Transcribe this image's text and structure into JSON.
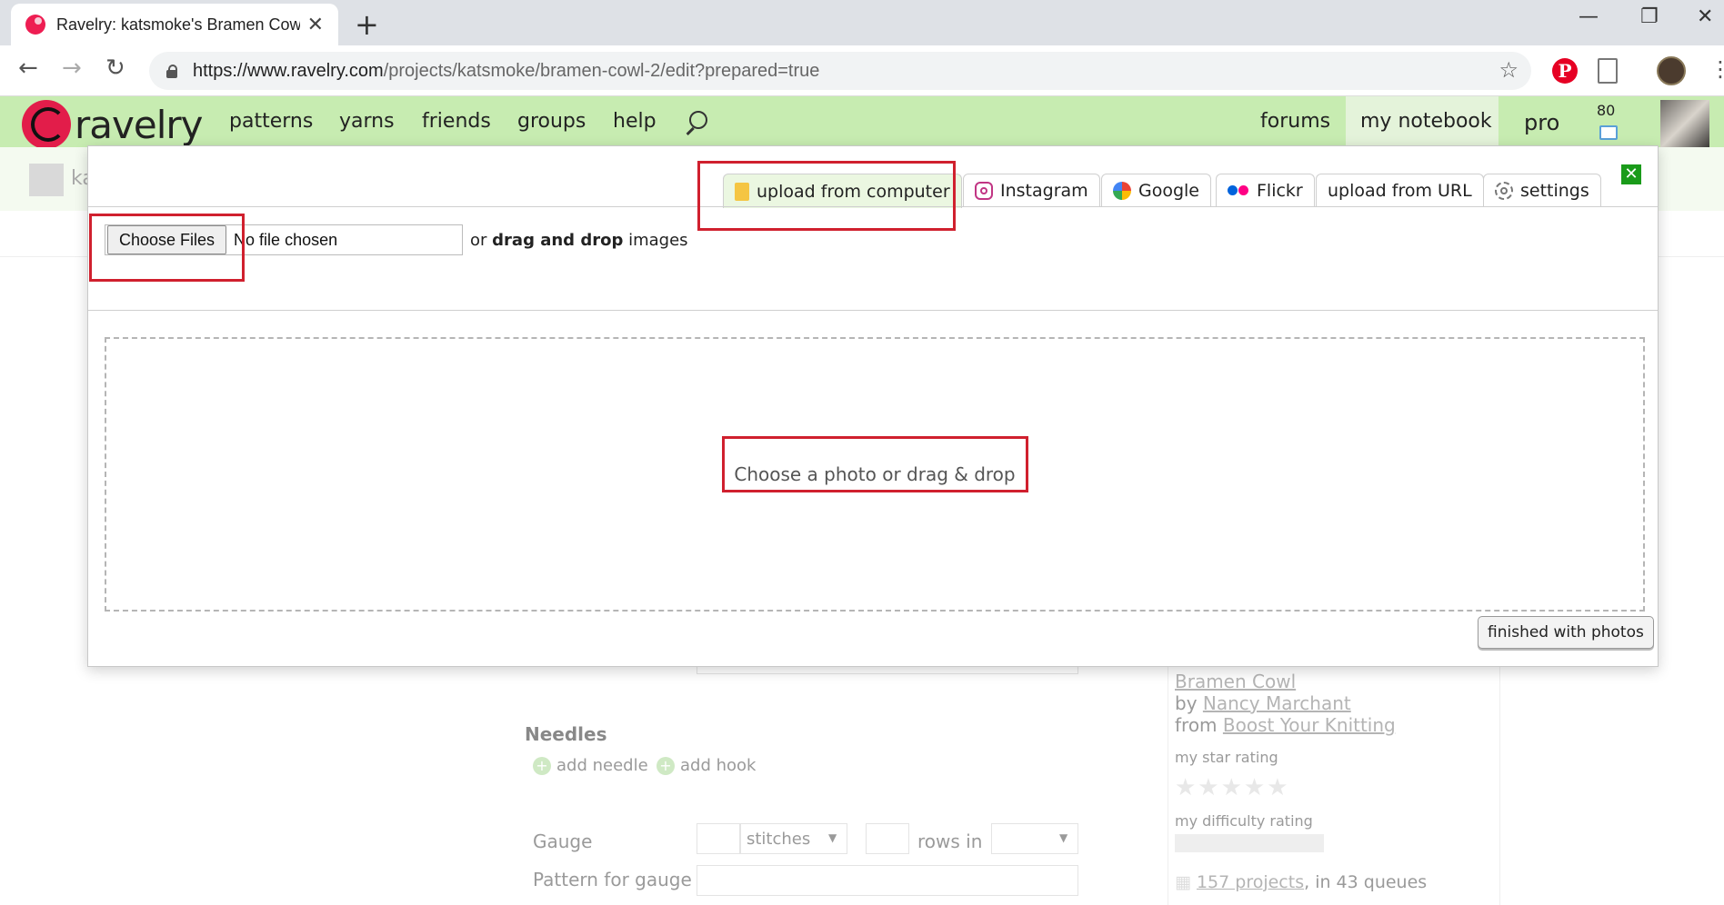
{
  "browser": {
    "tab_title": "Ravelry: katsmoke's Bramen Cowl",
    "tab_close": "✕",
    "new_tab": "+",
    "url_host": "https://www.ravelry.com",
    "url_path": "/projects/katsmoke/bramen-cowl-2/edit?prepared=true"
  },
  "ravelry_nav": {
    "logo": "ravelry",
    "items": [
      "patterns",
      "yarns",
      "friends",
      "groups",
      "help"
    ],
    "right": [
      "forums",
      "my notebook",
      "pro"
    ],
    "notification_count": "80"
  },
  "background": {
    "subbar_user": "ka",
    "needles_heading": "Needles",
    "add_needle": "add needle",
    "add_hook": "add hook",
    "gauge_label": "Gauge",
    "stitches": "stitches",
    "rows_in": "rows in",
    "pattern_for_gauge": "Pattern for gauge",
    "pattern_name": "Bramen Cowl",
    "by": "by",
    "designer": "Nancy Marchant",
    "from": "from",
    "source": "Boost Your Knitting",
    "my_star_rating": "my star rating",
    "stars": "★★★★★",
    "my_difficulty_rating": "my difficulty rating",
    "projects_link": "157 projects",
    "queues_text": ", in 43 queues"
  },
  "modal": {
    "tabs": [
      {
        "label": "upload from computer",
        "icon": "folder-icon",
        "active": true
      },
      {
        "label": "Instagram",
        "icon": "instagram-icon",
        "active": false
      },
      {
        "label": "Google",
        "icon": "google-photos-icon",
        "active": false
      },
      {
        "label": "Flickr",
        "icon": "flickr-icon",
        "active": false
      },
      {
        "label": "upload from URL",
        "icon": "",
        "active": false
      },
      {
        "label": "settings",
        "icon": "gear-icon",
        "active": false
      }
    ],
    "close_label": "✕",
    "choose_files": "Choose Files",
    "no_file": "No file chosen",
    "or": "or",
    "drag_drop": "drag and drop",
    "images": "images",
    "dropzone_text": "Choose a photo or drag & drop",
    "finished_button": "finished with photos"
  },
  "colors": {
    "ravelry_green": "#c7ecb1",
    "highlight_red": "#d0202e",
    "active_tab": "#ebf7e1"
  }
}
